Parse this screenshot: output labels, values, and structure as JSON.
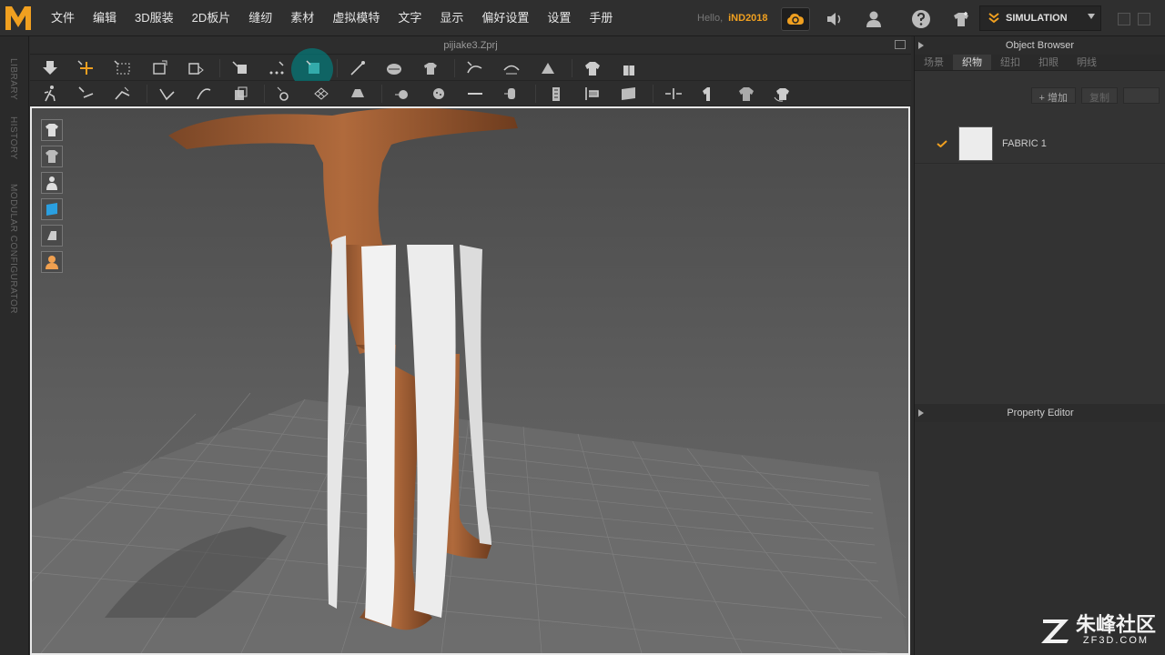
{
  "menu": {
    "items": [
      "文件",
      "编辑",
      "3D服装",
      "2D板片",
      "缝纫",
      "素材",
      "虚拟模特",
      "文字",
      "显示",
      "偏好设置",
      "设置",
      "手册"
    ]
  },
  "header": {
    "hello_label": "Hello,",
    "user": "iND2018",
    "mode_label": "SIMULATION"
  },
  "side_tabs": [
    "LIBRARY",
    "HISTORY",
    "MODULAR CONFIGURATOR"
  ],
  "file": {
    "title": "pijiake3.Zprj"
  },
  "object_browser": {
    "title": "Object Browser",
    "tabs": [
      "场景",
      "织物",
      "纽扣",
      "扣眼",
      "明线"
    ],
    "active_tab": "织物",
    "add_button": "+ 增加",
    "copy_button": "复制",
    "fabrics": [
      {
        "name": "FABRIC 1",
        "color": "#ececec"
      }
    ]
  },
  "property_editor": {
    "title": "Property Editor"
  },
  "watermark": {
    "main": "朱峰社区",
    "sub": "ZF3D.COM"
  },
  "colors": {
    "accent": "#f0a020",
    "viewport_border": "#e8e8e8",
    "active_tool": "#008282"
  }
}
